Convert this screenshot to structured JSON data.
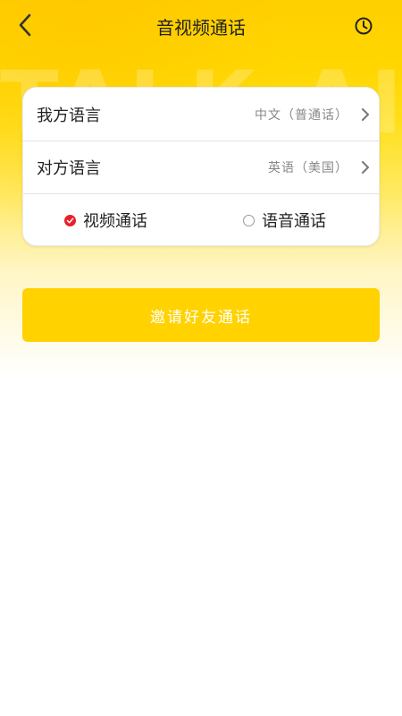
{
  "header": {
    "title": "音视频通话",
    "back_icon": "chevron-left-icon",
    "history_icon": "clock-icon"
  },
  "banner": {
    "watermark_text": "TALK·AI"
  },
  "language_card": {
    "my_language": {
      "label": "我方语言",
      "value": "中文（普通话）"
    },
    "other_language": {
      "label": "对方语言",
      "value": "英语（美国）"
    },
    "call_modes": [
      {
        "label": "视频通话",
        "selected": true
      },
      {
        "label": "语音通话",
        "selected": false
      }
    ]
  },
  "actions": {
    "invite_label": "邀请好友通话"
  },
  "colors": {
    "brand_yellow": "#ffd200",
    "selected_radio": "#e8202a",
    "text_primary": "#222222",
    "text_secondary": "#888888"
  }
}
